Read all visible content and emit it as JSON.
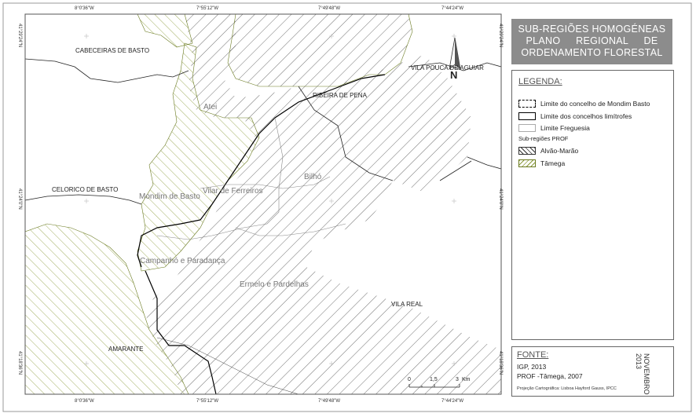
{
  "title": {
    "line1": "SUB-REGIÕES HOMOGÉNEAS",
    "line2": "PLANO REGIONAL DE",
    "line3": "ORDENAMENTO FLORESTAL"
  },
  "legend": {
    "heading": "LEGENDA:",
    "items": [
      {
        "label": "Limite do concelho de Mondim Basto"
      },
      {
        "label": "Limite dos concelhos limítrofes"
      },
      {
        "label": "Limite Freguesia"
      }
    ],
    "subregions_heading": "Sub-regiões PROF",
    "subregions": [
      {
        "label": "Alvão-Marão"
      },
      {
        "label": "Tâmega"
      }
    ]
  },
  "source": {
    "heading": "FONTE:",
    "line1": "IGP, 2013",
    "line2": "PROF -Tâmega, 2007",
    "projection": "Projeção Cartográfica: Lisboa Hayford Gauss, IPCC"
  },
  "date": "NOVEMBRO\n2013",
  "places": {
    "cabeceiras": "CABECEIRAS DE BASTO",
    "vila_pouca": "VILA POUCA DE AGUIAR",
    "ribeira_pena": "RIBEIRA DE PENA",
    "celorico": "CELORICO DE BASTO",
    "vila_real": "VILA REAL",
    "amarante": "AMARANTE"
  },
  "parishes": {
    "atei": "Atei",
    "bilho": "Bilhó",
    "vilar": "Vilar de Ferreiros",
    "mondim": "Mondim de Basto",
    "campanho": "Campanhó e Paradança",
    "ermelo": "Ermelo e Pardelhas"
  },
  "coords": {
    "top": [
      "8°0'36\"W",
      "7°55'12\"W",
      "7°49'48\"W",
      "7°44'24\"W"
    ],
    "bottom": [
      "8°0'36\"W",
      "7°55'12\"W",
      "7°49'48\"W",
      "7°44'24\"W"
    ],
    "left": [
      "41°29'24\"N",
      "41°24'0\"N",
      "41°18'36\"N"
    ],
    "right": [
      "41°29'24\"N",
      "41°24'0\"N",
      "41°18'36\"N"
    ]
  },
  "north_label": "N",
  "scale": {
    "labels": [
      "0",
      "1,5",
      "3"
    ],
    "unit": "Km"
  },
  "colors": {
    "tamega_hatch": "#8a9a3a",
    "alvao_hatch": "#333333",
    "title_bg": "#8c8c8c",
    "tamega_border": "#6a7a20"
  }
}
